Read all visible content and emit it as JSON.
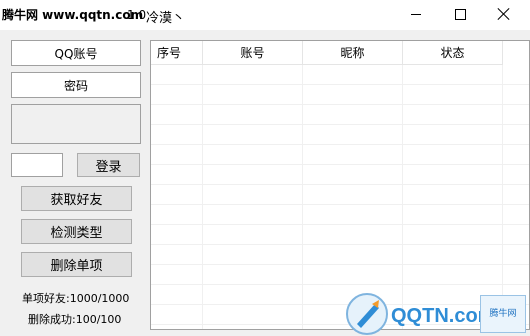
{
  "window": {
    "watermark": "腾牛网 www.qqtn.com",
    "version_fragment": "1.0",
    "title": "冷漠丶"
  },
  "left": {
    "qq_account_label": "QQ账号",
    "password_label": "密码",
    "captcha_value": "",
    "login_label": "登录",
    "get_friends_label": "获取好友",
    "detect_type_label": "检测类型",
    "delete_single_label": "删除单项",
    "stats": {
      "single_friends": "单项好友:1000/1000",
      "delete_success": "删除成功:100/100"
    }
  },
  "table": {
    "columns": [
      "序号",
      "账号",
      "昵称",
      "状态"
    ],
    "rows": []
  },
  "brand": {
    "logo_text": "QQTN.com",
    "badge_text": "腾牛网"
  }
}
